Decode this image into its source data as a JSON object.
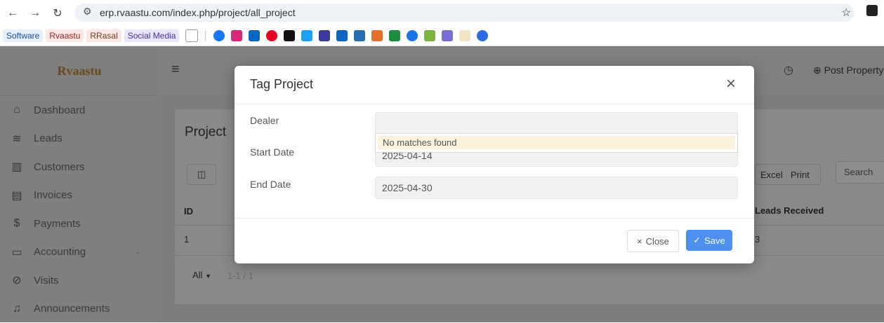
{
  "browser": {
    "url": "erp.rvaastu.com/index.php/project/all_project",
    "bookmarks": [
      "Software",
      "Rvaastu",
      "RRasal",
      "Social Media"
    ],
    "colors": {
      "software": "#e6f0fb",
      "rvaastu": "#fde8e8",
      "rrasal": "#fde8e8",
      "social": "#e9e6fb"
    }
  },
  "app": {
    "logo": "Rvaastu",
    "sidebar": {
      "items": [
        {
          "label": "Dashboard",
          "icon": "home-icon"
        },
        {
          "label": "Leads",
          "icon": "layers-icon"
        },
        {
          "label": "Customers",
          "icon": "building-icon"
        },
        {
          "label": "Invoices",
          "icon": "document-icon"
        },
        {
          "label": "Payments",
          "icon": "dollar-icon"
        },
        {
          "label": "Accounting",
          "icon": "monitor-icon"
        },
        {
          "label": "Visits",
          "icon": "check-circle-icon"
        },
        {
          "label": "Announcements",
          "icon": "bell-icon"
        }
      ]
    },
    "topbar": {
      "post_property": "Post Property"
    },
    "page": {
      "heading": "Project",
      "buttons": {
        "excel": "Excel",
        "print": "Print"
      },
      "search_placeholder": "Search",
      "columns": {
        "id": "ID",
        "leads": "Leads Received"
      },
      "row": {
        "id": "1",
        "leads": "3"
      },
      "pager": {
        "all": "All",
        "range": "1-1 / 1"
      }
    }
  },
  "modal": {
    "title": "Tag Project",
    "dealer_label": "Dealer",
    "dealer_value": "",
    "dropdown_message": "No matches found",
    "start_label": "Start Date",
    "start_value": "2025-04-14",
    "end_label": "End Date",
    "end_value": "2025-04-30",
    "close_label": "Close",
    "save_label": "Save"
  }
}
